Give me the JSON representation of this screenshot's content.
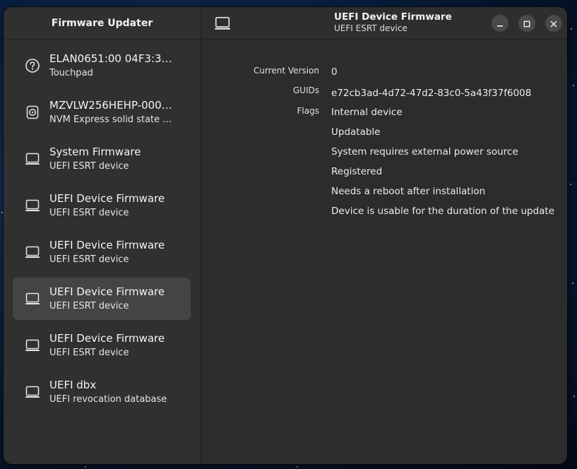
{
  "sidebar": {
    "title": "Firmware Updater",
    "devices": [
      {
        "name": "ELAN0651:00 04F3:3…",
        "subtitle": "Touchpad",
        "icon": "help-circle-icon"
      },
      {
        "name": "MZVLW256HEHP-000…",
        "subtitle": "NVM Express solid state …",
        "icon": "disk-drive-icon"
      },
      {
        "name": "System Firmware",
        "subtitle": "UEFI ESRT device",
        "icon": "computer-icon"
      },
      {
        "name": "UEFI Device Firmware",
        "subtitle": "UEFI ESRT device",
        "icon": "computer-icon"
      },
      {
        "name": "UEFI Device Firmware",
        "subtitle": "UEFI ESRT device",
        "icon": "computer-icon"
      },
      {
        "name": "UEFI Device Firmware",
        "subtitle": "UEFI ESRT device",
        "icon": "computer-icon",
        "selected": true
      },
      {
        "name": "UEFI Device Firmware",
        "subtitle": "UEFI ESRT device",
        "icon": "computer-icon"
      },
      {
        "name": "UEFI dbx",
        "subtitle": "UEFI revocation database",
        "icon": "computer-icon"
      }
    ]
  },
  "header": {
    "title": "UEFI Device Firmware",
    "subtitle": "UEFI ESRT device",
    "icon": "computer-icon"
  },
  "details": {
    "current_version_label": "Current Version",
    "current_version_value": "0",
    "guids_label": "GUIDs",
    "guids_value": "e72cb3ad-4d72-47d2-83c0-5a43f37f6008",
    "flags_label": "Flags",
    "flags": [
      "Internal device",
      "Updatable",
      "System requires external power source",
      "Registered",
      "Needs a reboot after installation",
      "Device is usable for the duration of the update"
    ]
  },
  "window_controls": {
    "minimize_icon": "minimize-icon",
    "maximize_icon": "maximize-icon",
    "close_icon": "close-icon"
  },
  "colors": {
    "window_bg": "#2c2c2c",
    "sidebar_bg": "#303030",
    "selected_row_bg": "#444444",
    "desktop_bg": "#0d2a52"
  }
}
